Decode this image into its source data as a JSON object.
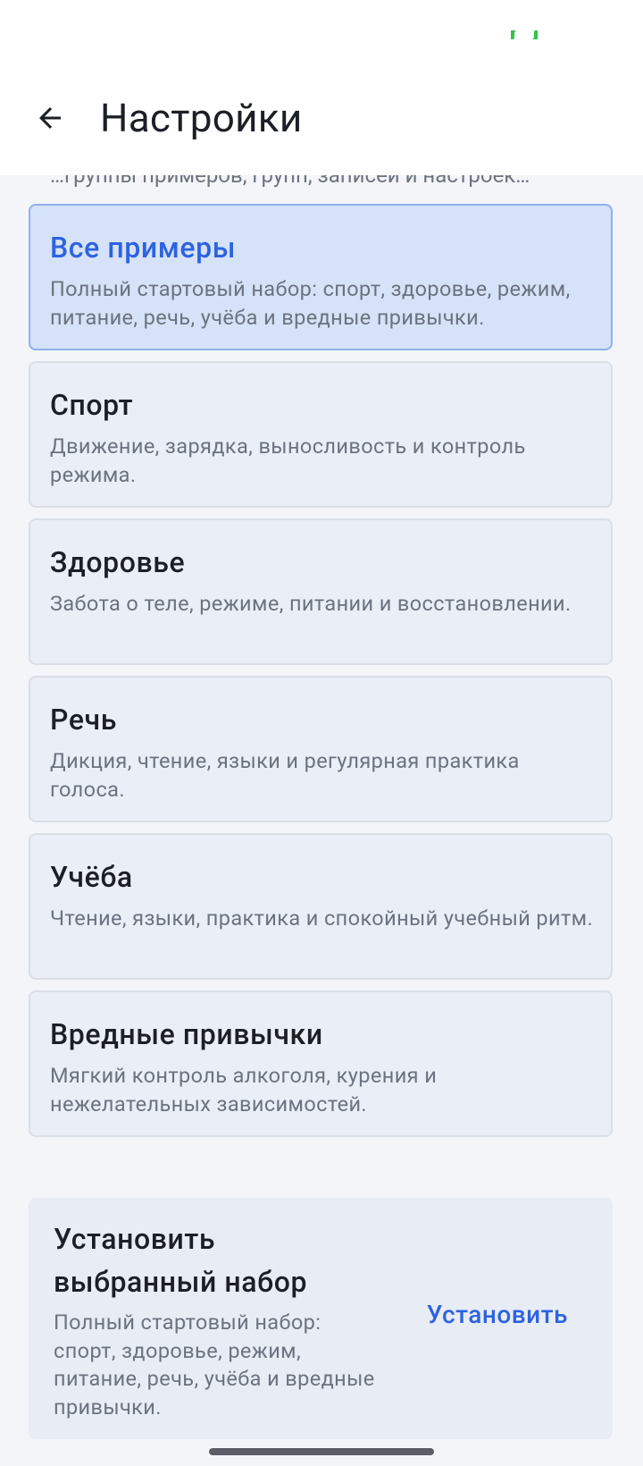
{
  "status_bar": {
    "indicator_color": "#33c24a"
  },
  "app_bar": {
    "title": "Настройки",
    "back_icon": "arrow-left-icon"
  },
  "content": {
    "clipped_text": "…группы примеров, групп, записей и настроек…",
    "sets": [
      {
        "title": "Все примеры",
        "description": "Полный стартовый набор: спорт, здоровье, режим, питание, речь, учёба и вредные привычки.",
        "selected": true
      },
      {
        "title": "Спорт",
        "description": "Движение, зарядка, выносливость и контроль режима.",
        "selected": false
      },
      {
        "title": "Здоровье",
        "description": "Забота о теле, режиме, питании и восстановлении.",
        "selected": false
      },
      {
        "title": "Речь",
        "description": "Дикция, чтение, языки и регулярная практика голоса.",
        "selected": false
      },
      {
        "title": "Учёба",
        "description": "Чтение, языки, практика и спокойный учебный ритм.",
        "selected": false
      },
      {
        "title": "Вредные привычки",
        "description": "Мягкий контроль алкоголя, курения и нежелательных зависимостей.",
        "selected": false
      }
    ]
  },
  "install_panel": {
    "title": "Установить выбранный набор",
    "description": "Полный стартовый набор: спорт, здоровье, режим, питание, речь, учёба и вредные привычки.",
    "button_label": "Установить"
  },
  "colors": {
    "accent": "#2d63e0",
    "selected_bg": "#d6e2f7",
    "card_bg": "#eaeef6"
  }
}
